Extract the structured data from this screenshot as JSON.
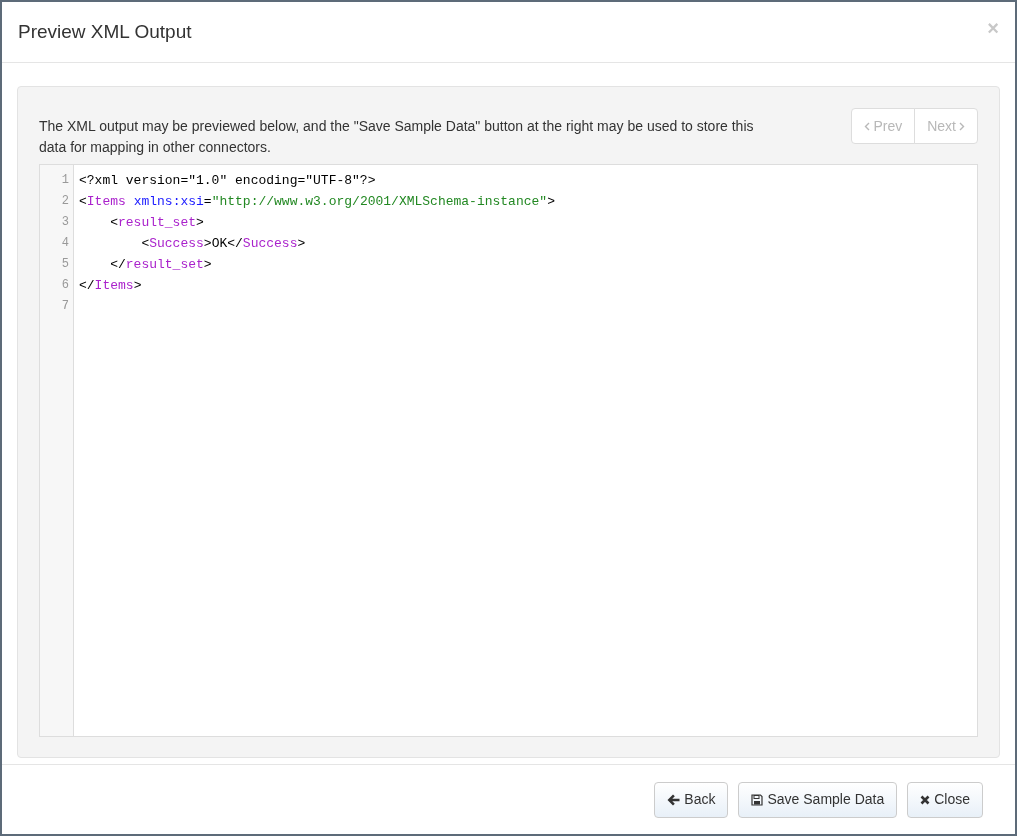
{
  "dialog": {
    "title": "Preview XML Output",
    "close_glyph": "×"
  },
  "intro": "The XML output may be previewed below, and the \"Save Sample Data\" button at the right may be used to store this data for mapping in other connectors.",
  "pager": [
    {
      "label": "Prev",
      "kind": "prev",
      "disabled": true
    },
    {
      "label": "Next",
      "kind": "next",
      "disabled": true
    }
  ],
  "code_lines": [
    {
      "number": "1",
      "tokens": [
        {
          "kind": "plain",
          "text": "<?xml version=\"1.0\" encoding=\"UTF-8\"?>"
        }
      ]
    },
    {
      "number": "2",
      "tokens": [
        {
          "kind": "plain",
          "text": "<"
        },
        {
          "kind": "tag",
          "text": "Items"
        },
        {
          "kind": "attr",
          "text": " xmlns:xsi"
        },
        {
          "kind": "plain",
          "text": "="
        },
        {
          "kind": "string",
          "text": "\"http://www.w3.org/2001/XMLSchema-instance\""
        },
        {
          "kind": "plain",
          "text": ">"
        }
      ]
    },
    {
      "number": "3",
      "tokens": [
        {
          "kind": "plain",
          "text": "    <"
        },
        {
          "kind": "tag",
          "text": "result_set"
        },
        {
          "kind": "plain",
          "text": ">"
        }
      ]
    },
    {
      "number": "4",
      "tokens": [
        {
          "kind": "plain",
          "text": "        <"
        },
        {
          "kind": "tag",
          "text": "Success"
        },
        {
          "kind": "plain",
          "text": ">OK</"
        },
        {
          "kind": "tag",
          "text": "Success"
        },
        {
          "kind": "plain",
          "text": ">"
        }
      ]
    },
    {
      "number": "5",
      "tokens": [
        {
          "kind": "plain",
          "text": "    </"
        },
        {
          "kind": "tag",
          "text": "result_set"
        },
        {
          "kind": "plain",
          "text": ">"
        }
      ]
    },
    {
      "number": "6",
      "tokens": [
        {
          "kind": "plain",
          "text": "</"
        },
        {
          "kind": "tag",
          "text": "Items"
        },
        {
          "kind": "plain",
          "text": ">"
        }
      ]
    },
    {
      "number": "7"
    }
  ],
  "footer_buttons": [
    {
      "label": "Back",
      "kind": "back"
    },
    {
      "label": "Save Sample Data",
      "kind": "save"
    },
    {
      "label": "Close",
      "kind": "close"
    }
  ]
}
